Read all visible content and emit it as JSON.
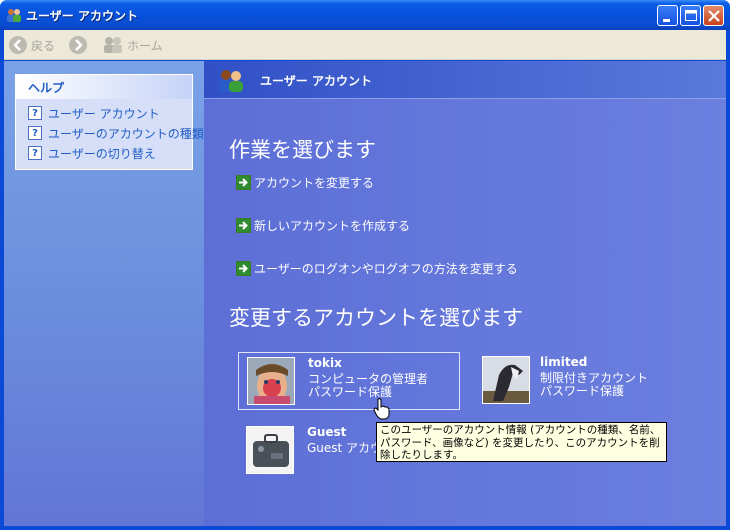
{
  "window": {
    "title": "ユーザー アカウント"
  },
  "toolbar": {
    "back_label": "戻る",
    "home_label": "ホーム"
  },
  "help": {
    "title": "ヘルプ",
    "items": [
      {
        "label": "ユーザー アカウント",
        "icon": "help-icon"
      },
      {
        "label": "ユーザーのアカウントの種類",
        "icon": "help-icon"
      },
      {
        "label": "ユーザーの切り替え",
        "icon": "help-icon"
      }
    ]
  },
  "main": {
    "header_title": "ユーザー アカウント",
    "task_heading": "作業を選びます",
    "tasks": [
      {
        "label": "アカウントを変更する"
      },
      {
        "label": "新しいアカウントを作成する"
      },
      {
        "label": "ユーザーのログオンやログオフの方法を変更する"
      }
    ],
    "account_heading": "変更するアカウントを選びます",
    "accounts": [
      {
        "name": "tokix",
        "type": "コンピュータの管理者",
        "status": "パスワード保護",
        "picture": "child-face-photo"
      },
      {
        "name": "limited",
        "type": "制限付きアカウント",
        "status": "パスワード保護",
        "picture": "horse-photo"
      },
      {
        "name": "Guest",
        "type": "Guest アカウン",
        "picture": "suitcase-photo"
      }
    ],
    "tooltip": "このユーザーのアカウント情報 (アカウントの種類、名前、パスワード、画像など) を変更したり、このアカウントを削除したりします。"
  },
  "colors": {
    "title_bar": "#0a4ad6",
    "content_bg": "#6375d6",
    "link": "#215dc6",
    "task_arrow": "#2e8b2e"
  }
}
